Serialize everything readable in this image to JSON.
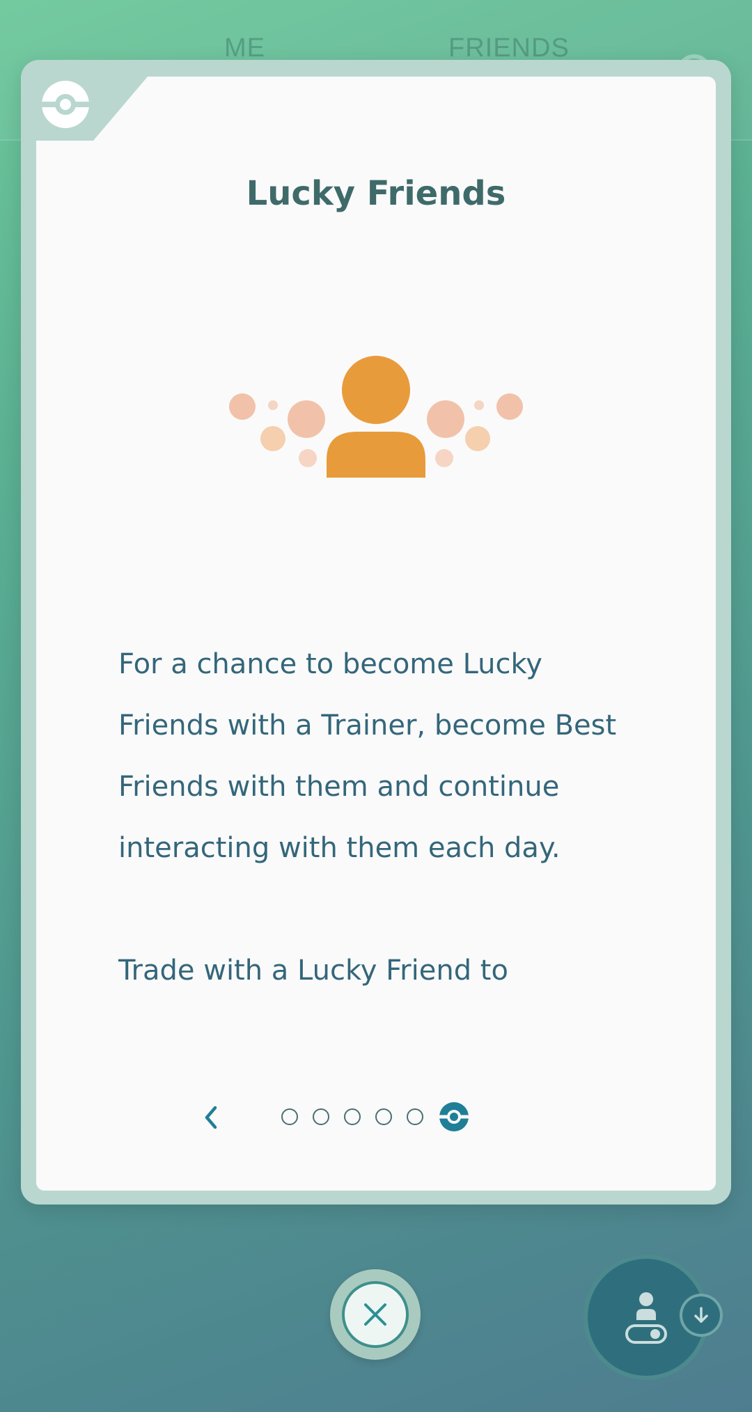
{
  "background": {
    "tabs": [
      {
        "label": "ME"
      },
      {
        "label": "FRIENDS"
      }
    ]
  },
  "modal": {
    "title": "Lucky Friends",
    "paragraphs": [
      "For a chance to become Lucky Friends with a Trainer, become Best Friends with them and continue interacting with them each day.",
      "Trade with a Lucky Friend to"
    ],
    "pager": {
      "total_pages": 6,
      "current_page": 6
    }
  },
  "icons": {
    "corner": "pokeball-icon",
    "illustration": "lucky-friend-icon",
    "back": "chevron-left-icon",
    "close": "close-icon",
    "fab": "trainer-toggle-icon",
    "download": "arrow-down-icon"
  },
  "colors": {
    "accent": "#1f7f96",
    "title": "#3f6a6a",
    "body_text": "#34667a",
    "illustration_person": "#e89b3a",
    "frame": "#b9d7cf"
  }
}
